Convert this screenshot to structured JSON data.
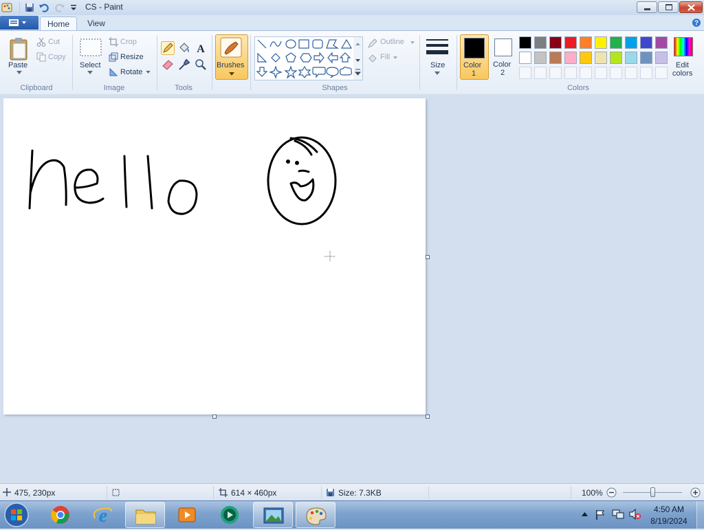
{
  "window": {
    "title": "CS - Paint",
    "controls": [
      "minimize",
      "maximize",
      "close"
    ]
  },
  "tabs": {
    "home": "Home",
    "view": "View"
  },
  "ribbon": {
    "clipboard": {
      "group_label": "Clipboard",
      "paste": "Paste",
      "cut": "Cut",
      "copy": "Copy"
    },
    "image": {
      "group_label": "Image",
      "select": "Select",
      "crop": "Crop",
      "resize": "Resize",
      "rotate": "Rotate"
    },
    "tools": {
      "group_label": "Tools",
      "items": [
        "pencil",
        "fill",
        "text",
        "eraser",
        "color-picker",
        "magnifier"
      ]
    },
    "brushes": {
      "label": "Brushes"
    },
    "shapes": {
      "group_label": "Shapes",
      "outline": "Outline",
      "fill": "Fill"
    },
    "size": {
      "label": "Size"
    },
    "colors": {
      "group_label": "Colors",
      "color1_label": "Color",
      "color1_num": "1",
      "color2_label": "Color",
      "color2_num": "2",
      "color1_value": "#000000",
      "color2_value": "#ffffff",
      "edit_label_1": "Edit",
      "edit_label_2": "colors",
      "palette_row1": [
        "#000000",
        "#7f7f7f",
        "#880015",
        "#ed1c24",
        "#ff7f27",
        "#fff200",
        "#22b14c",
        "#00a2e8",
        "#3f48cc",
        "#a349a4"
      ],
      "palette_row2": [
        "#ffffff",
        "#c3c3c3",
        "#b97a57",
        "#ffaec9",
        "#ffc90e",
        "#efe4b0",
        "#b5e61d",
        "#99d9ea",
        "#7092be",
        "#c8bfe7"
      ]
    }
  },
  "canvas": {
    "drawing": "hello text and smiley face",
    "background": "#ffffff"
  },
  "status": {
    "cursor_pos": "475, 230px",
    "canvas_size": "614 × 460px",
    "file_size": "Size: 7.3KB",
    "zoom": "100%"
  },
  "taskbar": {
    "apps": [
      "start",
      "chrome",
      "internet-explorer",
      "file-explorer",
      "media-player",
      "media-center",
      "photo-viewer",
      "paint"
    ],
    "time": "4:50 AM",
    "date": "8/19/2024"
  }
}
